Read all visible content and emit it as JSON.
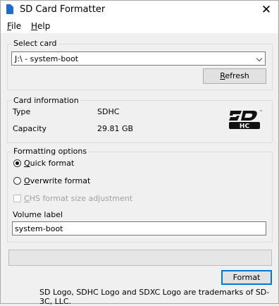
{
  "window": {
    "title": "SD Card Formatter",
    "close_glyph": "✕"
  },
  "menu": {
    "file": "File",
    "help": "Help"
  },
  "select_card": {
    "label": "Select card",
    "selected": "J:\\ - system-boot",
    "refresh": "Refresh"
  },
  "card_info": {
    "label": "Card information",
    "type_label": "Type",
    "type_value": "SDHC",
    "capacity_label": "Capacity",
    "capacity_value": "29.81 GB"
  },
  "formatting": {
    "label": "Formatting options",
    "quick": "Quick format",
    "overwrite": "Overwrite format",
    "chs": "CHS format size adjustment",
    "selected": "quick",
    "chs_checked": false,
    "chs_enabled": false,
    "volume_label_caption": "Volume label",
    "volume_label_value": "system-boot"
  },
  "progress": {
    "value": 0
  },
  "footer": {
    "format_button": "Format",
    "trademark": "SD Logo, SDHC Logo and SDXC Logo are trademarks of SD-3C, LLC."
  },
  "icons": {
    "app": "sd-card-icon",
    "logo": "sdhc-logo"
  },
  "colors": {
    "accent": "#0078d7",
    "app_icon": "#1e6bd6"
  }
}
